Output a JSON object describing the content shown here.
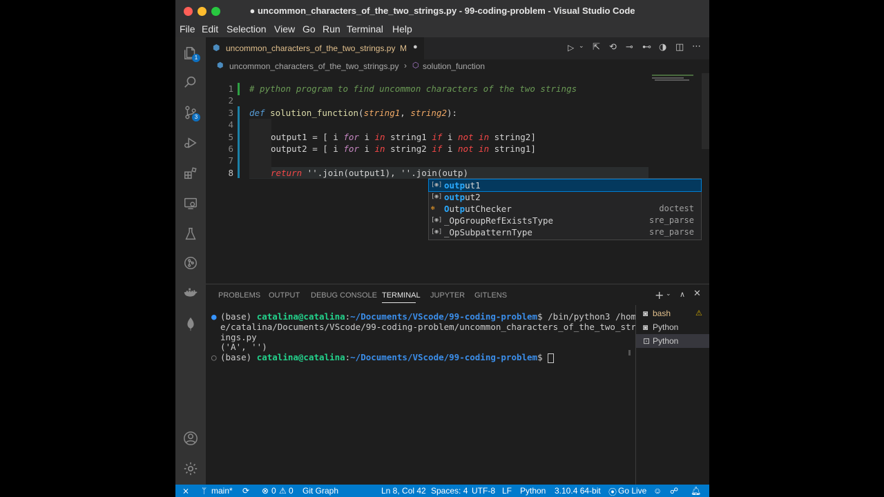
{
  "window": {
    "title": "uncommon_characters_of_the_two_strings.py - 99-coding-problem - Visual Studio Code",
    "modified_dot": "●"
  },
  "menu": [
    "File",
    "Edit",
    "Selection",
    "View",
    "Go",
    "Run",
    "Terminal",
    "Help"
  ],
  "activity_badges": {
    "explorer": "1",
    "scm": "3"
  },
  "tab": {
    "filename": "uncommon_characters_of_the_two_strings.py",
    "status": "M"
  },
  "breadcrumb": {
    "file": "uncommon_characters_of_the_two_strings.py",
    "symbol": "solution_function",
    "sep": "›"
  },
  "editor": {
    "line_numbers": [
      "1",
      "2",
      "3",
      "4",
      "5",
      "6",
      "7",
      "8"
    ],
    "lines": {
      "l1_comment": "# python program to find uncommon characters of the two strings",
      "l3_def": "def",
      "l3_fn": "solution_function",
      "l3_open": "(",
      "l3_p1": "string1",
      "l3_comma": ", ",
      "l3_p2": "string2",
      "l3_close": "):",
      "l5_a": "output1 = [ i ",
      "l5_for": "for",
      "l5_b": " i ",
      "l5_in": "in",
      "l5_c": " string1 ",
      "l5_if": "if",
      "l5_d": " i ",
      "l5_notin": "not in",
      "l5_e": " string2]",
      "l6_a": "output2 = [ i ",
      "l6_for": "for",
      "l6_b": " i ",
      "l6_in": "in",
      "l6_c": " string2 ",
      "l6_if": "if",
      "l6_d": " i ",
      "l6_notin": "not in",
      "l6_e": " string1]",
      "l8_return": "return",
      "l8_rest": " ''.join(output1), ''.join(outp)"
    }
  },
  "suggestions": [
    {
      "pre": "",
      "hl1": "outp",
      "post": "ut1",
      "detail": ""
    },
    {
      "pre": "",
      "hl1": "outp",
      "post": "ut2",
      "detail": ""
    },
    {
      "pre": "",
      "hl1": "O",
      "mid": "ut",
      "hl2": "p",
      "post": "utChecker",
      "detail": "doctest"
    },
    {
      "text": "_OpGroupRefExistsType",
      "detail": "sre_parse"
    },
    {
      "text": "_OpSubpatternType",
      "detail": "sre_parse"
    }
  ],
  "panel": {
    "tabs": [
      "PROBLEMS",
      "OUTPUT",
      "DEBUG CONSOLE",
      "TERMINAL",
      "JUPYTER",
      "GITLENS"
    ],
    "active_tab": "TERMINAL"
  },
  "terminal": {
    "line1_prefix": "(base) ",
    "line1_user": "catalina@catalina",
    "line1_colon": ":",
    "line1_path": "~/Documents/VScode/99-coding-problem",
    "line1_cmd": "$ /bin/python3 /hom",
    "line2": "e/catalina/Documents/VScode/99-coding-problem/uncommon_characters_of_the_two_str",
    "line3": "ings.py",
    "line4": "('A', '')",
    "line5_prefix": "(base) ",
    "line5_user": "catalina@catalina",
    "line5_colon": ":",
    "line5_path": "~/Documents/VScode/99-coding-problem",
    "line5_prompt": "$ "
  },
  "terminal_list": [
    "bash",
    "Python",
    "Python"
  ],
  "status": {
    "branch": "main*",
    "errors": "0",
    "warnings": "0",
    "git_graph": "Git Graph",
    "position": "Ln 8, Col 42",
    "spaces": "Spaces: 4",
    "encoding": "UTF-8",
    "eol": "LF",
    "language": "Python",
    "interpreter": "3.10.4 64-bit",
    "golive": "Go Live"
  }
}
